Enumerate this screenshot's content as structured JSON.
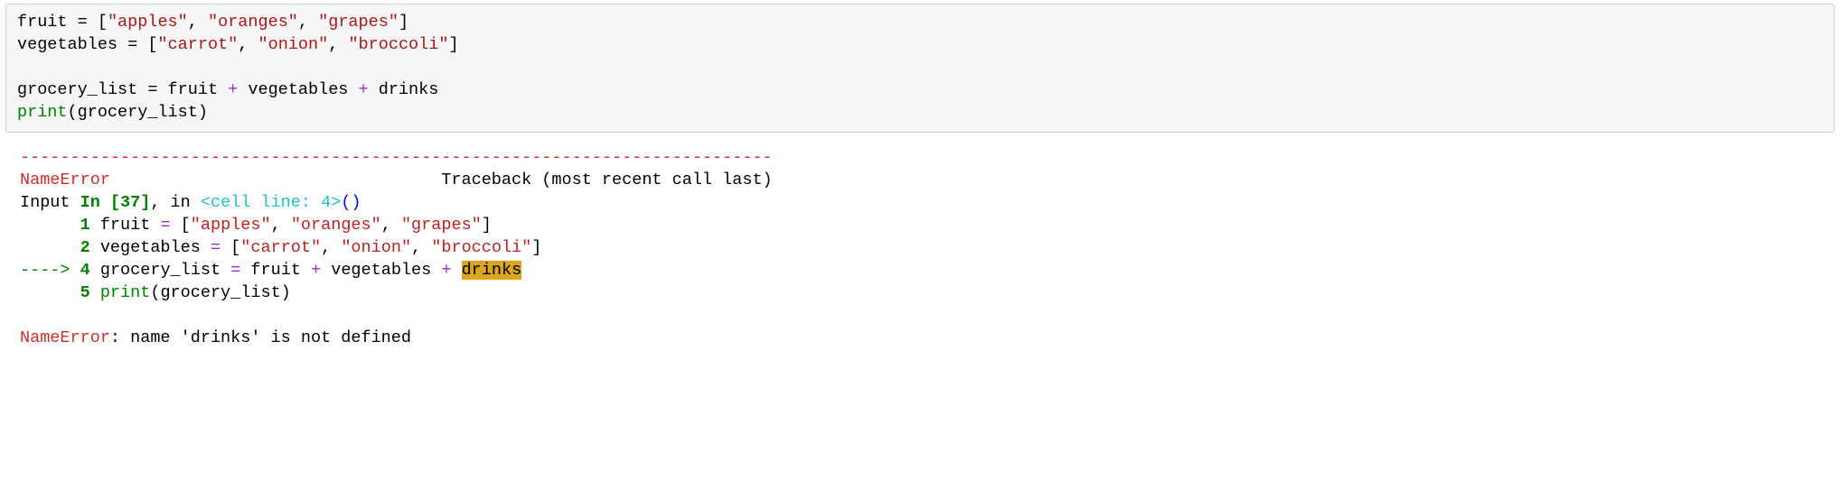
{
  "code": {
    "line1": {
      "var": "fruit",
      "eq": " = [",
      "s1": "\"apples\"",
      "c1": ", ",
      "s2": "\"oranges\"",
      "c2": ", ",
      "s3": "\"grapes\"",
      "close": "]"
    },
    "line2": {
      "var": "vegetables",
      "eq": " = [",
      "s1": "\"carrot\"",
      "c1": ", ",
      "s2": "\"onion\"",
      "c2": ", ",
      "s3": "\"broccoli\"",
      "close": "]"
    },
    "line4": {
      "var": "grocery_list",
      "eq": " = ",
      "a": "fruit",
      "p1": " + ",
      "b": "vegetables",
      "p2": " + ",
      "c": "drinks"
    },
    "line5": {
      "fn": "print",
      "open": "(",
      "arg": "grocery_list",
      "close": ")"
    }
  },
  "traceback": {
    "dashes": "---------------------------------------------------------------------------",
    "err_type": "NameError",
    "tb_label": "                                 Traceback (most recent call last)",
    "input_prefix": "Input ",
    "in_label": "In [37]",
    "in_sep": ", in ",
    "cell_line": "<cell line: 4>",
    "parens": "()",
    "line1_num": "      1",
    "line1_txt": " fruit ",
    "line1_eq": "=",
    "line1_rest_open": " [",
    "line1_s1": "\"apples\"",
    "line1_c1": ", ",
    "line1_s2": "\"oranges\"",
    "line1_c2": ", ",
    "line1_s3": "\"grapes\"",
    "line1_close": "]",
    "line2_num": "      2",
    "line2_txt": " vegetables ",
    "line2_eq": "=",
    "line2_rest_open": " [",
    "line2_s1": "\"carrot\"",
    "line2_c1": ", ",
    "line2_s2": "\"onion\"",
    "line2_c2": ", ",
    "line2_s3": "\"broccoli\"",
    "line2_close": "]",
    "arrow": "----> ",
    "line4_num": "4",
    "line4_txt": " grocery_list ",
    "line4_eq": "=",
    "line4_a": " fruit ",
    "line4_p1": "+",
    "line4_b": " vegetables ",
    "line4_p2": "+",
    "line4_sp": " ",
    "line4_hl": "drinks",
    "line5_num": "      5",
    "line5_fn": " print",
    "line5_arg": "(grocery_list)",
    "final_err": "NameError",
    "final_msg": ": name 'drinks' is not defined"
  }
}
